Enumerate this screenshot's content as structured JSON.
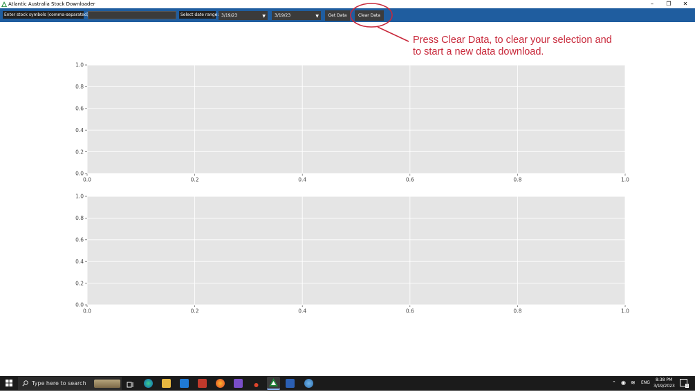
{
  "window": {
    "title": "Atlantic Australia Stock Downloader",
    "minimize_glyph": "–",
    "restore_glyph": "❐",
    "close_glyph": "✕"
  },
  "toolbar": {
    "symbols_label": "Enter stock symbols (comma-separated):",
    "symbols_value": "",
    "date_range_label": "Select date range:",
    "start_date": "3/19/23",
    "end_date": "3/19/23",
    "get_data_label": "Get Data",
    "clear_data_label": "Clear Data"
  },
  "annotation": {
    "text": "Press Clear Data, to clear your selection and\nto start a new data download.",
    "color": "#c8283a"
  },
  "chart_data": [
    {
      "type": "line",
      "x": [],
      "y": [],
      "xlim": [
        0.0,
        1.0
      ],
      "ylim": [
        0.0,
        1.0
      ],
      "x_ticks": [
        "0.0",
        "0.2",
        "0.4",
        "0.6",
        "0.8",
        "1.0"
      ],
      "y_ticks": [
        "0.0",
        "0.2",
        "0.4",
        "0.6",
        "0.8",
        "1.0"
      ],
      "grid": true,
      "background": "#e5e5e5"
    },
    {
      "type": "line",
      "x": [],
      "y": [],
      "xlim": [
        0.0,
        1.0
      ],
      "ylim": [
        0.0,
        1.0
      ],
      "x_ticks": [
        "0.0",
        "0.2",
        "0.4",
        "0.6",
        "0.8",
        "1.0"
      ],
      "y_ticks": [
        "0.0",
        "0.2",
        "0.4",
        "0.6",
        "0.8",
        "1.0"
      ],
      "grid": true,
      "background": "#e5e5e5"
    }
  ],
  "taskbar": {
    "search_placeholder": "Type here to search",
    "apps": [
      "task-view-icon",
      "edge-icon",
      "file-explorer-icon",
      "mail-icon",
      "office-icon",
      "firefox-icon",
      "visual-studio-icon",
      "media-icon",
      "stock-downloader-app-icon",
      "word-icon",
      "python-icon"
    ],
    "language": "ENG",
    "time": "8:38 PM",
    "date": "3/19/2023",
    "notification_count": "1"
  }
}
